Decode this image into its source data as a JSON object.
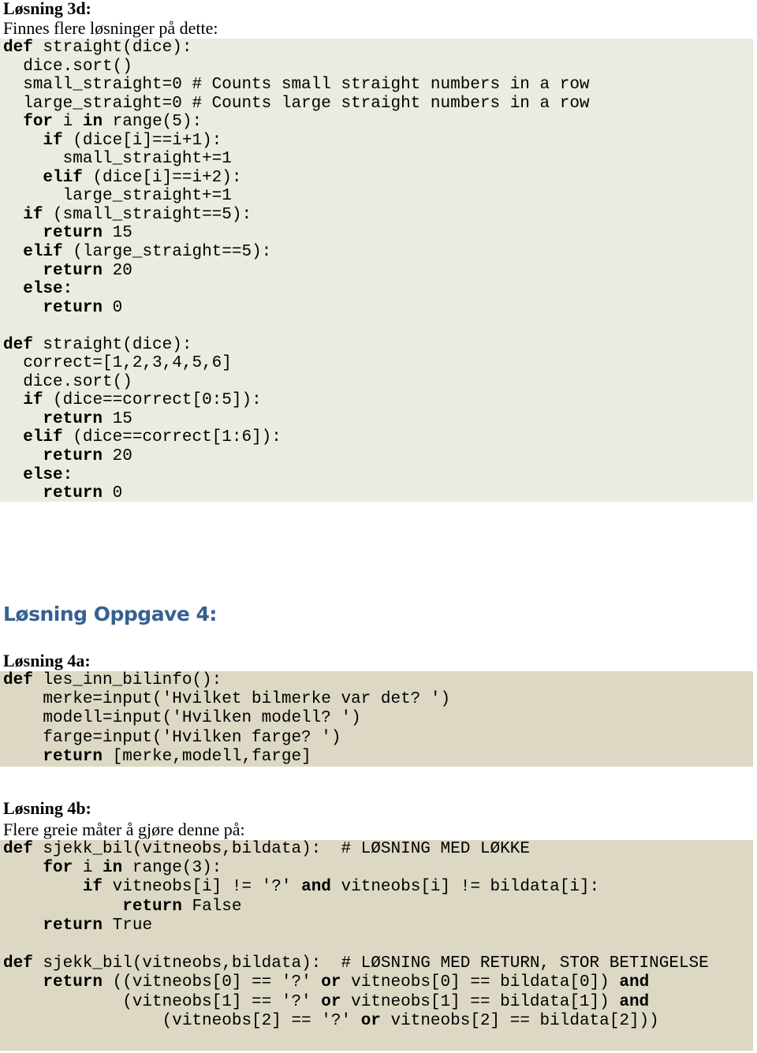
{
  "section_3d": {
    "heading": "Løsning 3d:",
    "intro": "Finnes flere løsninger på dette:",
    "code_block_color": "#ecebe1",
    "code": [
      [
        {
          "k": 1,
          "t": "def"
        },
        {
          "t": " straight(dice):"
        }
      ],
      [
        {
          "t": "  dice.sort()"
        }
      ],
      [
        {
          "t": "  small_straight=0 # Counts small straight numbers in a row"
        }
      ],
      [
        {
          "t": "  large_straight=0 # Counts large straight numbers in a row"
        }
      ],
      [
        {
          "t": "  "
        },
        {
          "k": 1,
          "t": "for"
        },
        {
          "t": " i "
        },
        {
          "k": 1,
          "t": "in"
        },
        {
          "t": " range(5):"
        }
      ],
      [
        {
          "t": "    "
        },
        {
          "k": 1,
          "t": "if"
        },
        {
          "t": " (dice[i]==i+1):"
        }
      ],
      [
        {
          "t": "      small_straight+=1"
        }
      ],
      [
        {
          "t": "    "
        },
        {
          "k": 1,
          "t": "elif"
        },
        {
          "t": " (dice[i]==i+2):"
        }
      ],
      [
        {
          "t": "      large_straight+=1"
        }
      ],
      [
        {
          "t": "  "
        },
        {
          "k": 1,
          "t": "if"
        },
        {
          "t": " (small_straight==5):"
        }
      ],
      [
        {
          "t": "    "
        },
        {
          "k": 1,
          "t": "return"
        },
        {
          "t": " 15"
        }
      ],
      [
        {
          "t": "  "
        },
        {
          "k": 1,
          "t": "elif"
        },
        {
          "t": " (large_straight==5):"
        }
      ],
      [
        {
          "t": "    "
        },
        {
          "k": 1,
          "t": "return"
        },
        {
          "t": " 20"
        }
      ],
      [
        {
          "t": "  "
        },
        {
          "k": 1,
          "t": "else:"
        }
      ],
      [
        {
          "t": "    "
        },
        {
          "k": 1,
          "t": "return"
        },
        {
          "t": " 0"
        }
      ],
      [
        {
          "t": ""
        }
      ],
      [
        {
          "k": 1,
          "t": "def"
        },
        {
          "t": " straight(dice):"
        }
      ],
      [
        {
          "t": "  correct=[1,2,3,4,5,6]"
        }
      ],
      [
        {
          "t": "  dice.sort()"
        }
      ],
      [
        {
          "t": "  "
        },
        {
          "k": 1,
          "t": "if"
        },
        {
          "t": " (dice==correct[0:5]):"
        }
      ],
      [
        {
          "t": "    "
        },
        {
          "k": 1,
          "t": "return"
        },
        {
          "t": " 15"
        }
      ],
      [
        {
          "t": "  "
        },
        {
          "k": 1,
          "t": "elif"
        },
        {
          "t": " (dice==correct[1:6]):"
        }
      ],
      [
        {
          "t": "    "
        },
        {
          "k": 1,
          "t": "return"
        },
        {
          "t": " 20"
        }
      ],
      [
        {
          "t": "  "
        },
        {
          "k": 1,
          "t": "else:"
        }
      ],
      [
        {
          "t": "    "
        },
        {
          "k": 1,
          "t": "return"
        },
        {
          "t": " 0"
        }
      ]
    ]
  },
  "section_4": {
    "heading": "Løsning Oppgave 4:",
    "heading_color": "#376092"
  },
  "section_4a": {
    "heading": "Løsning 4a:",
    "code_block_color": "#ddd8c4",
    "code": [
      [
        {
          "k": 1,
          "t": "def"
        },
        {
          "t": " les_inn_bilinfo():"
        }
      ],
      [
        {
          "t": "    merke=input('Hvilket bilmerke var det? ')"
        }
      ],
      [
        {
          "t": "    modell=input('Hvilken modell? ')"
        }
      ],
      [
        {
          "t": "    farge=input('Hvilken farge? ')"
        }
      ],
      [
        {
          "t": "    "
        },
        {
          "k": 1,
          "t": "return"
        },
        {
          "t": " [merke,modell,farge]"
        }
      ]
    ]
  },
  "section_4b": {
    "heading": "Løsning 4b:",
    "intro": "Flere greie måter å gjøre denne på:",
    "code_block_color": "#ddd8c4",
    "code": [
      [
        {
          "k": 1,
          "t": "def"
        },
        {
          "t": " sjekk_bil(vitneobs,bildata):  # LØSNING MED LØKKE"
        }
      ],
      [
        {
          "t": "    "
        },
        {
          "k": 1,
          "t": "for"
        },
        {
          "t": " i "
        },
        {
          "k": 1,
          "t": "in"
        },
        {
          "t": " range(3):"
        }
      ],
      [
        {
          "t": "        "
        },
        {
          "k": 1,
          "t": "if"
        },
        {
          "t": " vitneobs[i] != '?' "
        },
        {
          "k": 1,
          "t": "and"
        },
        {
          "t": " vitneobs[i] != bildata[i]:"
        }
      ],
      [
        {
          "t": "            "
        },
        {
          "k": 1,
          "t": "return"
        },
        {
          "t": " False"
        }
      ],
      [
        {
          "t": "    "
        },
        {
          "k": 1,
          "t": "return"
        },
        {
          "t": " True"
        }
      ],
      [
        {
          "t": ""
        }
      ],
      [
        {
          "k": 1,
          "t": "def"
        },
        {
          "t": " sjekk_bil(vitneobs,bildata):  # LØSNING MED RETURN, STOR BETINGELSE"
        }
      ],
      [
        {
          "t": "    "
        },
        {
          "k": 1,
          "t": "return"
        },
        {
          "t": " ((vitneobs[0] == '?' "
        },
        {
          "k": 1,
          "t": "or"
        },
        {
          "t": " vitneobs[0] == bildata[0]) "
        },
        {
          "k": 1,
          "t": "and"
        }
      ],
      [
        {
          "t": "            (vitneobs[1] == '?' "
        },
        {
          "k": 1,
          "t": "or"
        },
        {
          "t": " vitneobs[1] == bildata[1]) "
        },
        {
          "k": 1,
          "t": "and"
        }
      ],
      [
        {
          "t": "                (vitneobs[2] == '?' "
        },
        {
          "k": 1,
          "t": "or"
        },
        {
          "t": " vitneobs[2] == bildata[2]))"
        }
      ]
    ]
  }
}
